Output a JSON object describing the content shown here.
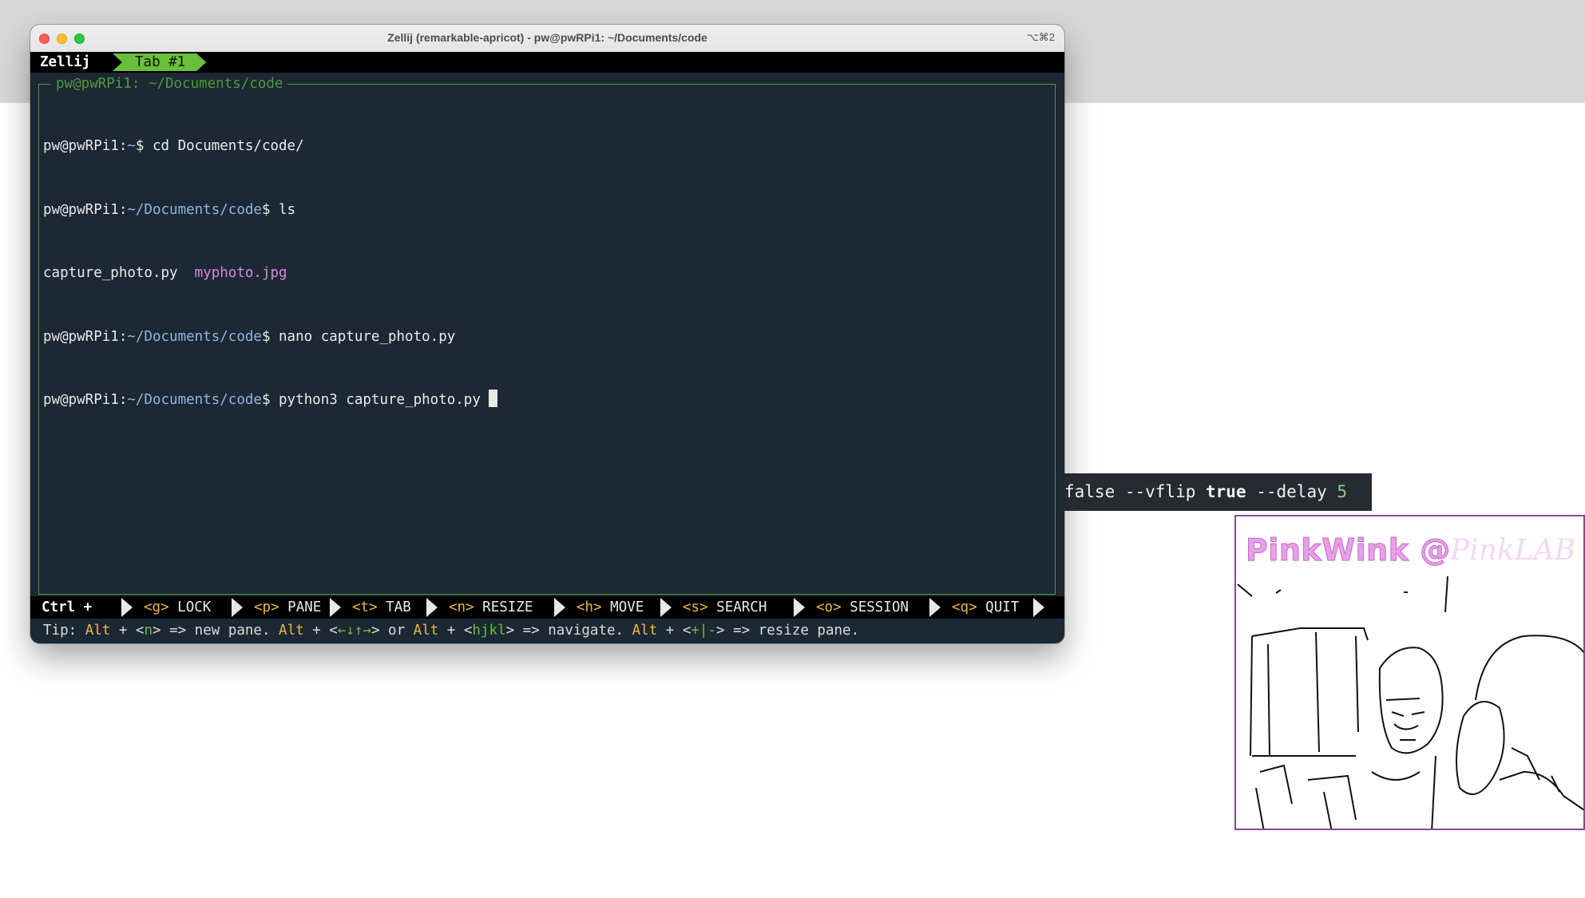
{
  "window": {
    "title": "Zellij (remarkable-apricot) - pw@pwRPi1: ~/Documents/code",
    "shortcut": "⌥⌘2"
  },
  "tabbar": {
    "app": "Zellij",
    "tab": "Tab #1"
  },
  "pane": {
    "title": "pw@pwRPi1: ~/Documents/code"
  },
  "terminal": {
    "lines": [
      {
        "user": "pw@pwRPi1:",
        "path": "~",
        "sym": "$ ",
        "cmd": "cd Documents/code/"
      },
      {
        "user": "pw@pwRPi1:",
        "path": "~/Documents/code",
        "sym": "$ ",
        "cmd": "ls"
      },
      {
        "out1": "capture_photo.py",
        "out2": "myphoto.jpg"
      },
      {
        "user": "pw@pwRPi1:",
        "path": "~/Documents/code",
        "sym": "$ ",
        "cmd": "nano capture_photo.py"
      },
      {
        "user": "pw@pwRPi1:",
        "path": "~/Documents/code",
        "sym": "$ ",
        "cmd": "python3 capture_photo.py "
      }
    ]
  },
  "modebar": {
    "ctrl": "Ctrl +",
    "items": [
      {
        "key": "<g>",
        "label": "LOCK"
      },
      {
        "key": "<p>",
        "label": "PANE"
      },
      {
        "key": "<t>",
        "label": "TAB"
      },
      {
        "key": "<n>",
        "label": "RESIZE"
      },
      {
        "key": "<h>",
        "label": "MOVE"
      },
      {
        "key": "<s>",
        "label": "SEARCH"
      },
      {
        "key": "<o>",
        "label": "SESSION"
      },
      {
        "key": "<q>",
        "label": "QUIT"
      }
    ]
  },
  "tip": {
    "prefix": "Tip: ",
    "alt": "Alt",
    "plus": " + <",
    "n": "n",
    "new_pane": "> => new pane. ",
    "arrows": "←↓↑→",
    "or": "> or ",
    "hjkl": "hjkl",
    "navigate": "> => navigate. ",
    "pm": "+|-",
    "resize": "> => resize pane."
  },
  "overlay": {
    "pre": "false --vflip ",
    "true_word": "true",
    "mid": " --delay ",
    "num": "5"
  },
  "preview": {
    "brand": "PinkWink @",
    "brand2": "PinkLAB"
  }
}
